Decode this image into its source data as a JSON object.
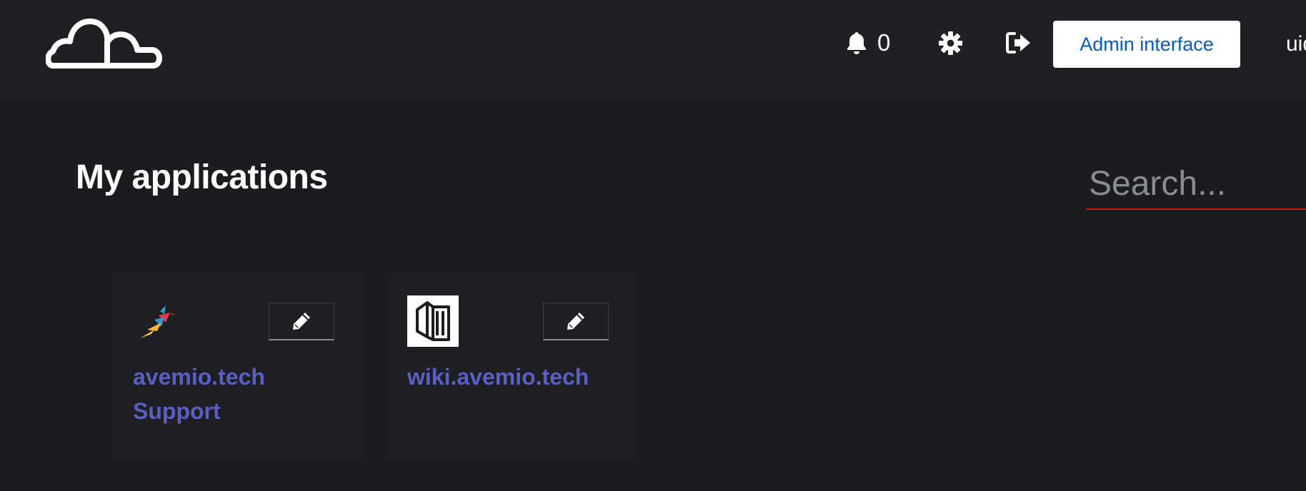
{
  "header": {
    "logo_icon": "cloud-logo-icon",
    "notifications": {
      "icon": "bell-icon",
      "count": "0"
    },
    "settings_icon": "gear-icon",
    "logout_icon": "sign-out-icon",
    "admin_button_label": "Admin interface",
    "user_name": "uid"
  },
  "main": {
    "title": "My applications",
    "search": {
      "placeholder": "Search...",
      "value": ""
    },
    "applications": [
      {
        "name": "avemio.tech Support",
        "icon": "bird-logo-icon",
        "edit_icon": "pencil-icon"
      },
      {
        "name": "wiki.avemio.tech",
        "icon": "wiki-book-icon",
        "edit_icon": "pencil-icon"
      }
    ]
  },
  "colors": {
    "background": "#1b1c1f",
    "header_background": "#1f2023",
    "card_background": "#1e1f22",
    "link": "#5a5fc0",
    "admin_button_text": "#0b5bbf",
    "search_underline": "#c9190b"
  }
}
